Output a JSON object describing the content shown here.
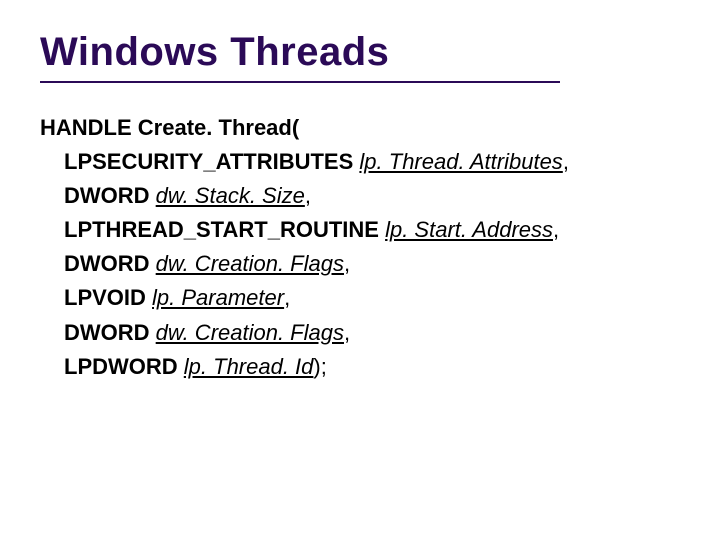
{
  "title": "Windows Threads",
  "signature": {
    "line0_kw_return": "HANDLE",
    "line0_kw_fn": "Create. Thread(",
    "params": [
      {
        "type": "LPSECURITY_ATTRIBUTES",
        "name": "lp. Thread. Attributes",
        "trail": ","
      },
      {
        "type": "DWORD",
        "name": "dw. Stack. Size",
        "trail": ","
      },
      {
        "type": "LPTHREAD_START_ROUTINE",
        "name": "lp. Start. Address",
        "trail": ","
      },
      {
        "type": "DWORD",
        "name": "dw. Creation. Flags",
        "trail": ","
      },
      {
        "type": "LPVOID",
        "name": "lp. Parameter",
        "trail": ","
      },
      {
        "type": "DWORD",
        "name": "dw. Creation. Flags",
        "trail": ","
      },
      {
        "type": "LPDWORD",
        "name": "lp. Thread. Id",
        "trail": ");"
      }
    ]
  }
}
